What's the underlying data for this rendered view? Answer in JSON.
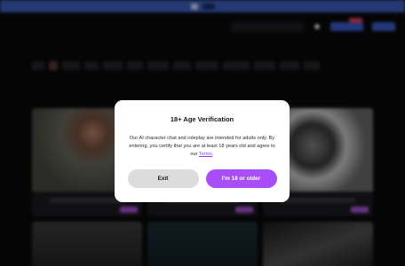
{
  "modal": {
    "title": "18+ Age Verification",
    "body_text": "Our AI character chat and roleplay are intended for adults only. By entering, you certify that you are at least 18 years old and agree to our ",
    "terms_link": "Terms",
    "body_end": ".",
    "exit_label": "Exit",
    "confirm_label": "I'm 18 or older"
  },
  "colors": {
    "accent_purple": "#a94ef7",
    "link_purple": "#8a3ef0",
    "exit_gray": "#dcdcdc",
    "banner_blue": "#3f63c7",
    "background": "#0a0a0c"
  }
}
